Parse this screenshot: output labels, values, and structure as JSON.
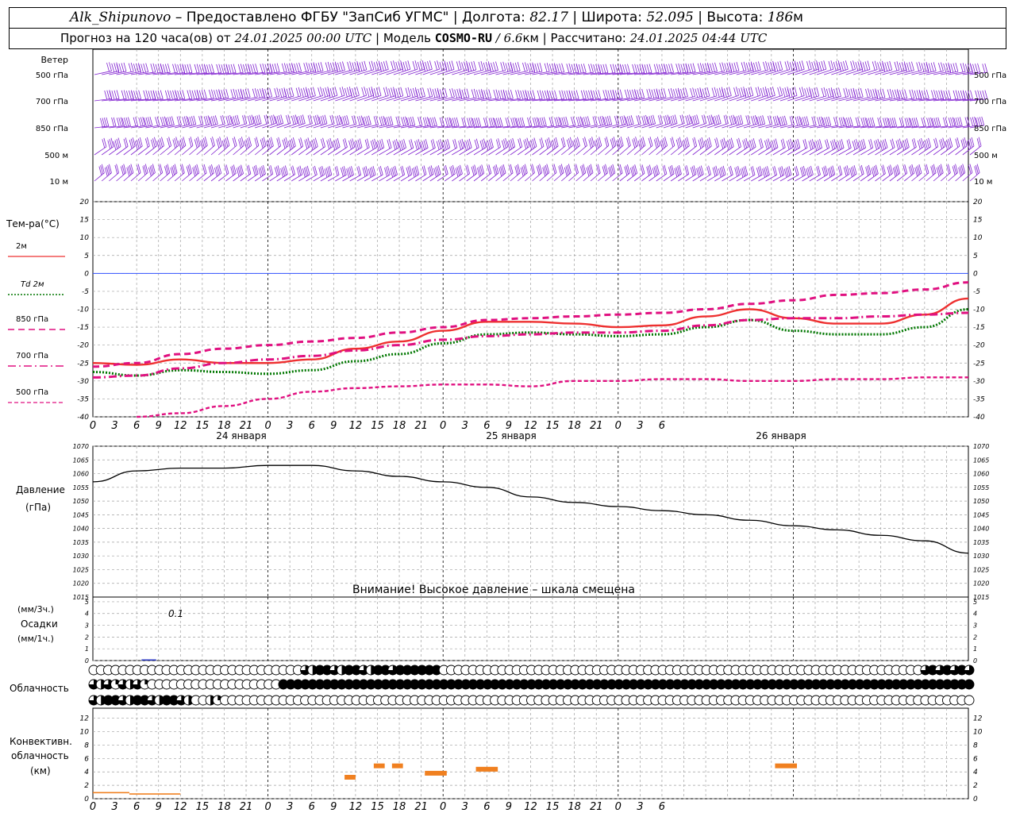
{
  "header": {
    "station": "Alk_Shipunovo",
    "provided_by": "– Предоставлено ФГБУ \"ЗапСиб УГМС\"",
    "lon_label": "Долгота:",
    "lon_value": "82.17",
    "lat_label": "Широта:",
    "lat_value": "52.095",
    "alt_label": "Высота:",
    "alt_value": "186",
    "alt_unit": "м",
    "forecast_label": "Прогноз на 120 часа(ов) от",
    "forecast_start": "24.01.2025 00:00 UTC",
    "model_label": "Модель",
    "model_name": "COSMO-RU",
    "model_res": "/ 6.6",
    "model_res_unit": "км",
    "computed_label": "Рассчитано:",
    "computed_at": "24.01.2025 04:44 UTC"
  },
  "colors": {
    "t2m": "#ee3030",
    "td2m": "#007700",
    "t850": "#e01080",
    "t700": "#e01080",
    "t500": "#e01080",
    "wind": "#8020d0",
    "pressure": "#000000",
    "precip": "#2030c0",
    "convective": "#f08020",
    "zero": "#3050ff",
    "grid": "#a0a0a0"
  },
  "wind_panel": {
    "title": "Ветер",
    "levels": [
      "500 гПа",
      "700 гПа",
      "850 гПа",
      "500 м",
      "10  м"
    ]
  },
  "temp_panel": {
    "title": "Тем-ра(°C)",
    "legend": [
      {
        "label": "2м",
        "style": "solid"
      },
      {
        "label": "Td  2м",
        "style": "dotted"
      },
      {
        "label": "850 гПа",
        "style": "dashed"
      },
      {
        "label": "700 гПа",
        "style": "dashdot"
      },
      {
        "label": "500 гПа",
        "style": "dashed-short"
      }
    ],
    "y_ticks": [
      20,
      15,
      10,
      5,
      0,
      -5,
      -10,
      -15,
      -20,
      -25,
      -30,
      -35,
      -40
    ]
  },
  "x_axis": {
    "hour_ticks": [
      "0",
      "3",
      "6",
      "9",
      "12",
      "15",
      "18",
      "21",
      "0",
      "3",
      "6",
      "9",
      "12",
      "15",
      "18",
      "21",
      "0",
      "3",
      "6",
      "9",
      "12",
      "15",
      "18",
      "21",
      "0",
      "3",
      "6"
    ],
    "days": [
      "24 января",
      "25 января",
      "26 января"
    ]
  },
  "pressure_panel": {
    "title_line1": "Давление",
    "title_line2": "(гПа)",
    "y_ticks": [
      1070,
      1065,
      1060,
      1055,
      1050,
      1045,
      1040,
      1035,
      1030,
      1025,
      1020,
      1015
    ],
    "warning": "Внимание! Высокое давление – шкала смещена"
  },
  "precip_panel": {
    "label_line1": "(мм/3ч.)",
    "label_line2": "Осадки",
    "label_line3": "(мм/1ч.)",
    "y_ticks": [
      5,
      4,
      3,
      2,
      1,
      0
    ],
    "max_label": "0.1"
  },
  "cloud_panel": {
    "title": "Облачность",
    "note": "three rows (high / middle / low) of 0-4 octa-quarter fill symbols every hour"
  },
  "convective_panel": {
    "title_line1": "Конвективн.",
    "title_line2": "облачность",
    "title_line3": "(км)",
    "y_ticks": [
      12,
      10,
      8,
      6,
      4,
      2,
      0
    ]
  },
  "chart_data": [
    {
      "type": "line",
      "name": "temperature",
      "x_hours": [
        0,
        6,
        12,
        18,
        24,
        30,
        36,
        42,
        48,
        54,
        60,
        66,
        72,
        78,
        84,
        90,
        96,
        102,
        108,
        114,
        120
      ],
      "ylim": [
        -40,
        20
      ],
      "series": [
        {
          "name": "2м",
          "values": [
            -25,
            -25.5,
            -24,
            -25,
            -25,
            -24,
            -21,
            -19,
            -16,
            -13.5,
            -13.5,
            -14,
            -15,
            -14.5,
            -12,
            -10,
            -12.5,
            -14,
            -14,
            -11.5,
            -7
          ]
        },
        {
          "name": "Td  2м",
          "values": [
            -27.5,
            -28.5,
            -27,
            -27.5,
            -28,
            -27,
            -24.5,
            -22.5,
            -19.5,
            -17,
            -16.5,
            -17,
            -17.5,
            -17,
            -15,
            -13,
            -16,
            -17,
            -17,
            -15,
            -10
          ]
        },
        {
          "name": "850 гПа",
          "values": [
            -26,
            -25,
            -22.5,
            -21,
            -20,
            -19,
            -18,
            -16.5,
            -15,
            -13,
            -12.5,
            -12,
            -11.5,
            -11,
            -10,
            -8.5,
            -7.5,
            -6,
            -5.5,
            -4.5,
            -2.5
          ]
        },
        {
          "name": "700 гПа",
          "values": [
            -29,
            -28.5,
            -26.5,
            -25,
            -24,
            -23,
            -21.5,
            -20,
            -18.5,
            -17.5,
            -17,
            -16.5,
            -16.5,
            -16,
            -14.5,
            -13,
            -12.5,
            -12.5,
            -12,
            -11.5,
            -11
          ]
        },
        {
          "name": "500 гПа",
          "values": [
            -45,
            -43,
            -39,
            -37,
            -35,
            -33,
            -32,
            -31.5,
            -31,
            -31,
            -31.5,
            -30,
            -30,
            -29.5,
            -29.5,
            -30,
            -30,
            -29.5,
            -29.5,
            -29,
            -29
          ]
        }
      ]
    },
    {
      "type": "line",
      "name": "pressure",
      "x_hours": [
        0,
        6,
        12,
        18,
        24,
        30,
        36,
        42,
        48,
        54,
        60,
        66,
        72,
        78,
        84,
        90,
        96,
        102,
        108,
        114,
        120
      ],
      "ylim": [
        1015,
        1070
      ],
      "series": [
        {
          "name": "Давление",
          "values": [
            1057,
            1061,
            1062,
            1062,
            1063,
            1063,
            1061,
            1059,
            1057,
            1055,
            1051.5,
            1049.5,
            1048,
            1046.5,
            1045,
            1043,
            1041,
            1039.5,
            1037.5,
            1035.5,
            1031
          ]
        }
      ]
    },
    {
      "type": "bar",
      "name": "precipitation",
      "x_hours": [
        7,
        8
      ],
      "ylim": [
        0,
        5
      ],
      "series": [
        {
          "name": "Осадки",
          "values": [
            0.1,
            0.1
          ]
        }
      ]
    },
    {
      "type": "bar",
      "name": "convective_cloud",
      "ylim": [
        0,
        13
      ],
      "series": [
        {
          "name": "segments_km",
          "values": [
            {
              "x0": 0,
              "x1": 5,
              "base": 0,
              "top": 1.0
            },
            {
              "x0": 5,
              "x1": 12,
              "base": 0,
              "top": 0.8
            },
            {
              "x0": 34.5,
              "x1": 36,
              "base": 3.2,
              "top": 3.2
            },
            {
              "x0": 38.5,
              "x1": 40,
              "base": 4.9,
              "top": 4.9
            },
            {
              "x0": 41,
              "x1": 42.5,
              "base": 4.9,
              "top": 4.9
            },
            {
              "x0": 45.5,
              "x1": 48.5,
              "base": 3.8,
              "top": 3.8
            },
            {
              "x0": 52.5,
              "x1": 55.5,
              "base": 4.4,
              "top": 4.4
            },
            {
              "x0": 93.5,
              "x1": 96.5,
              "base": 4.9,
              "top": 4.9
            }
          ]
        }
      ]
    }
  ]
}
